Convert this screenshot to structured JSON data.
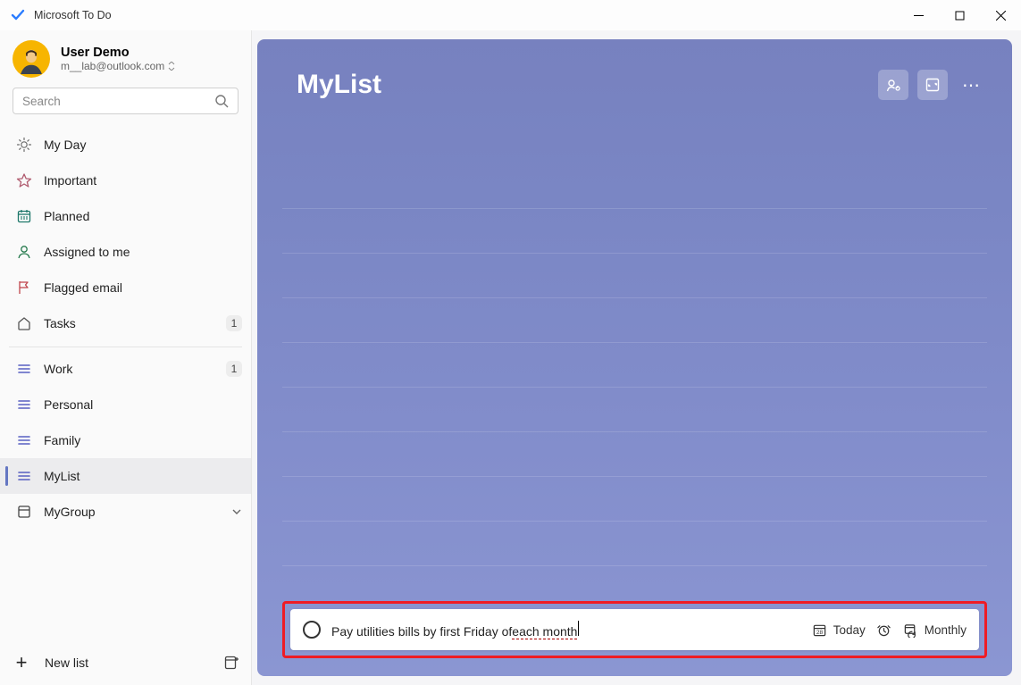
{
  "titlebar": {
    "app_name": "Microsoft To Do"
  },
  "user": {
    "name": "User Demo",
    "email": "m__lab@outlook.com"
  },
  "search": {
    "placeholder": "Search"
  },
  "sidebar": {
    "items": [
      {
        "label": "My Day"
      },
      {
        "label": "Important"
      },
      {
        "label": "Planned"
      },
      {
        "label": "Assigned to me"
      },
      {
        "label": "Flagged email"
      },
      {
        "label": "Tasks",
        "count": "1"
      },
      {
        "label": "Work",
        "count": "1"
      },
      {
        "label": "Personal"
      },
      {
        "label": "Family"
      },
      {
        "label": "MyList"
      },
      {
        "label": "MyGroup"
      }
    ],
    "new_list_label": "New list"
  },
  "main": {
    "title": "MyList",
    "addtask": {
      "text_before": "Pay utilities bills by first Friday of ",
      "text_underlined": "each month",
      "due_label": "Today",
      "repeat_label": "Monthly"
    }
  }
}
